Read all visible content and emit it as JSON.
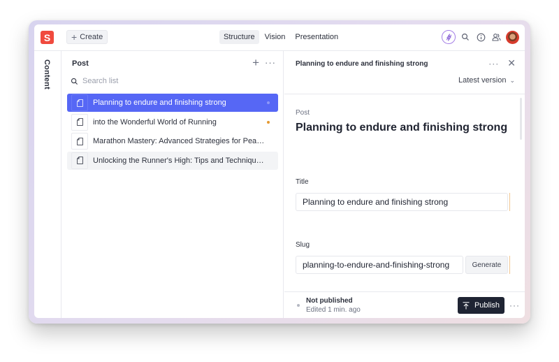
{
  "app": {
    "logo_letter": "S",
    "brand_color": "#f04a3e",
    "accent_color": "#5667f5"
  },
  "topbar": {
    "create_label": "Create",
    "tabs": [
      {
        "label": "Structure",
        "active": true
      },
      {
        "label": "Vision",
        "active": false
      },
      {
        "label": "Presentation",
        "active": false
      }
    ],
    "icons": [
      "lightning-icon",
      "search-icon",
      "info-icon",
      "users-icon",
      "user-avatar"
    ]
  },
  "rail": {
    "label": "Content"
  },
  "list_pane": {
    "title": "Post",
    "search_placeholder": "Search list",
    "items": [
      {
        "title": "Planning to endure and finishing strong",
        "selected": true,
        "status_color": "#8d98f8"
      },
      {
        "title": "into the Wonderful World of Running",
        "selected": false,
        "status_color": "#e59a32"
      },
      {
        "title": "Marathon Mastery: Advanced Strategies for Peak P...",
        "selected": false,
        "status_color": null
      },
      {
        "title": "Unlocking the Runner's High: Tips and Techniques f...",
        "selected": false,
        "hover": true,
        "status_color": null
      }
    ]
  },
  "document": {
    "header_title": "Planning to endure and finishing strong",
    "version_label": "Latest version",
    "type_label": "Post",
    "title": "Planning to endure and finishing strong",
    "fields": {
      "title": {
        "label": "Title",
        "value": "Planning to endure and finishing strong"
      },
      "slug": {
        "label": "Slug",
        "value": "planning-to-endure-and-finishing-strong",
        "generate_label": "Generate"
      }
    },
    "footer": {
      "status": "Not published",
      "edited": "Edited 1 min. ago",
      "publish_label": "Publish"
    }
  }
}
